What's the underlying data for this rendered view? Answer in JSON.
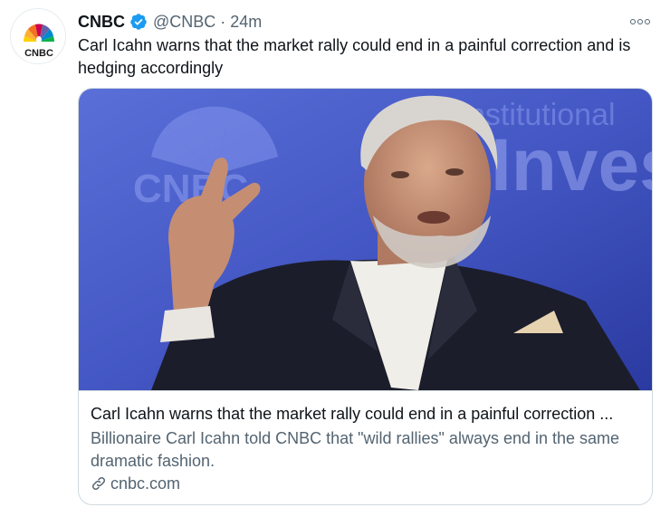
{
  "tweet": {
    "author_name": "CNBC",
    "verified": true,
    "handle": "@CNBC",
    "separator": "·",
    "time": "24m",
    "text": "Carl Icahn warns that the market rally could end in a painful correction and is hedging accordingly"
  },
  "avatar": {
    "logo_text": "CNBC",
    "icon": "cnbc-peacock-icon"
  },
  "card": {
    "image_backdrop_words": [
      "CNBC",
      "nstitutional",
      "Investor"
    ],
    "title": "Carl Icahn warns that the market rally could end in a painful correction ...",
    "description": "Billionaire Carl Icahn told CNBC that \"wild rallies\" always end in the same dramatic fashion.",
    "domain": "cnbc.com",
    "domain_icon": "link-icon"
  },
  "colors": {
    "text_primary": "#0f1419",
    "text_secondary": "#536471",
    "verified_blue": "#1d9bf0",
    "border": "#cfd9de"
  }
}
